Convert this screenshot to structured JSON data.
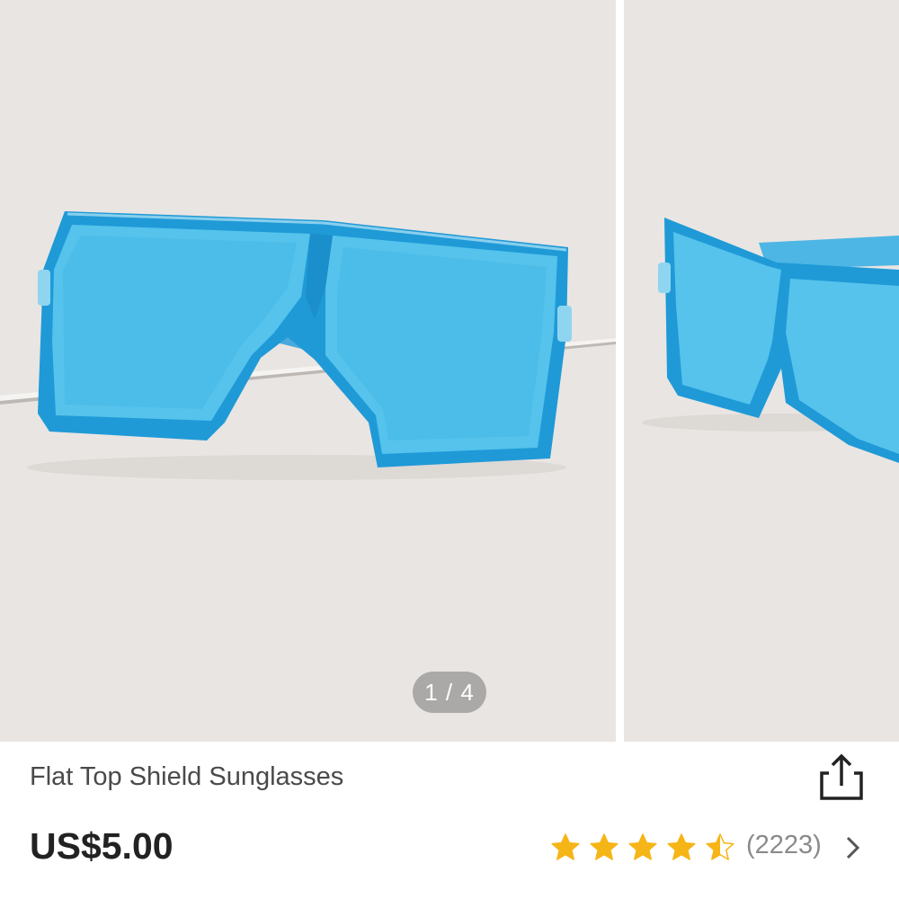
{
  "gallery": {
    "pager": "1 / 4",
    "image_current": 1,
    "image_total": 4
  },
  "product": {
    "title": "Flat Top Shield Sunglasses",
    "price": "US$5.00"
  },
  "rating": {
    "stars": 4.5,
    "count_text": "(2223)",
    "star_color": "#f6b516"
  },
  "icons": {
    "share": "share-icon",
    "chevron": "chevron-right-icon",
    "star": "star-icon"
  },
  "colors": {
    "lens": "#3fb3e6",
    "frame": "#2aa2df",
    "background": "#e9e5e2"
  }
}
